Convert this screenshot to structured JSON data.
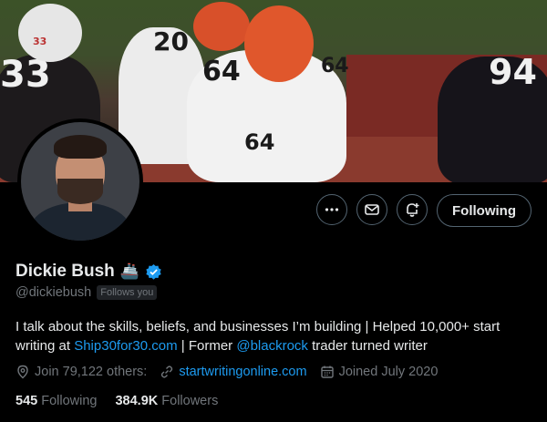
{
  "profile": {
    "name": "Dickie Bush",
    "name_emoji": "🚢",
    "handle": "@dickiebush",
    "follows_you_badge": "Follows you",
    "verified": true
  },
  "bio": {
    "part1": "I talk about the skills, beliefs, and businesses I’m building | Helped 10,000+ start writing at ",
    "link1": "Ship30for30.com",
    "part2": " | Former ",
    "link2": "@blackrock",
    "part3": " trader turned writer"
  },
  "meta": {
    "location": "Join 79,122 others:",
    "website": "startwritingonline.com",
    "joined": "Joined July 2020"
  },
  "stats": {
    "following_count": "545",
    "following_label": "Following",
    "followers_count": "384.9K",
    "followers_label": "Followers"
  },
  "actions": {
    "follow_label": "Following",
    "more_icon": "more-icon",
    "message_icon": "envelope-icon",
    "notify_icon": "bell-plus-icon"
  },
  "banner": {
    "jersey_numbers": [
      "33",
      "20",
      "64",
      "64",
      "94",
      "33",
      "64"
    ]
  },
  "colors": {
    "background": "#000000",
    "text_primary": "#e7e9ea",
    "text_secondary": "#71767b",
    "link": "#1d9bf0",
    "border": "#536471",
    "verified": "#1d9bf0"
  }
}
